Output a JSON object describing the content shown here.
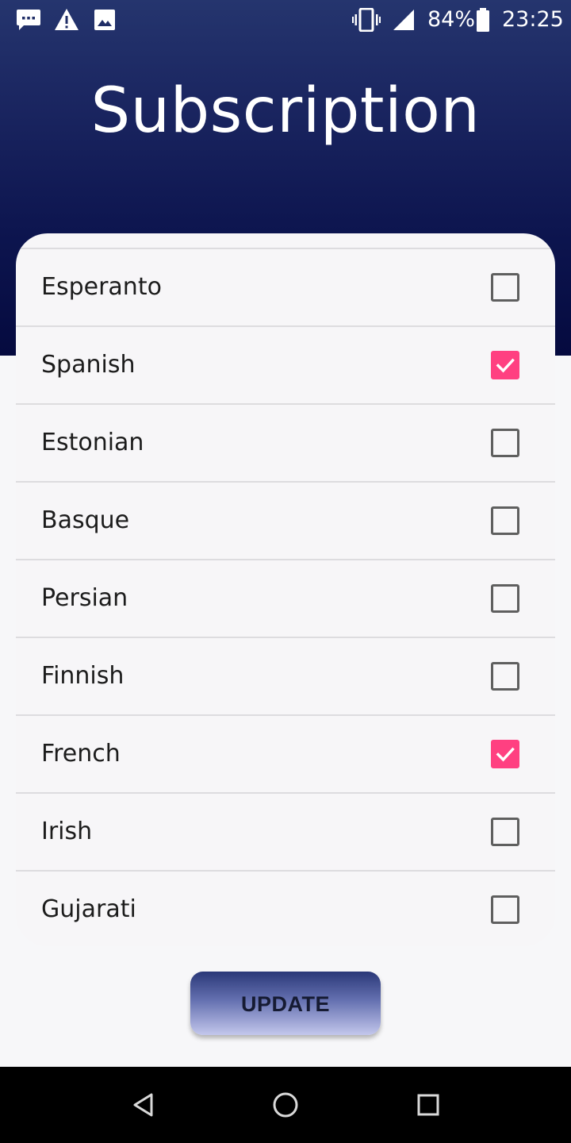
{
  "status_bar": {
    "battery_percent": "84%",
    "time": "23:25",
    "icons": [
      "message-notification-icon",
      "warning-icon",
      "image-icon",
      "vibrate-icon",
      "signal-icon",
      "battery-icon"
    ]
  },
  "header": {
    "title": "Subscription"
  },
  "languages": [
    {
      "label": "Esperanto",
      "checked": false
    },
    {
      "label": "Spanish",
      "checked": true
    },
    {
      "label": "Estonian",
      "checked": false
    },
    {
      "label": "Basque",
      "checked": false
    },
    {
      "label": "Persian",
      "checked": false
    },
    {
      "label": "Finnish",
      "checked": false
    },
    {
      "label": "French",
      "checked": true
    },
    {
      "label": "Irish",
      "checked": false
    },
    {
      "label": "Gujarati",
      "checked": false
    }
  ],
  "update_button": {
    "label": "UPDATE"
  },
  "nav_bar": {
    "icons": [
      "back-icon",
      "home-icon",
      "recents-icon"
    ]
  },
  "colors": {
    "header_gradient_top": "#25356e",
    "header_gradient_bottom": "#050a3f",
    "checkbox_accent": "#ff4081",
    "card_background": "#f7f6f8",
    "page_background": "#f7f7f9"
  }
}
